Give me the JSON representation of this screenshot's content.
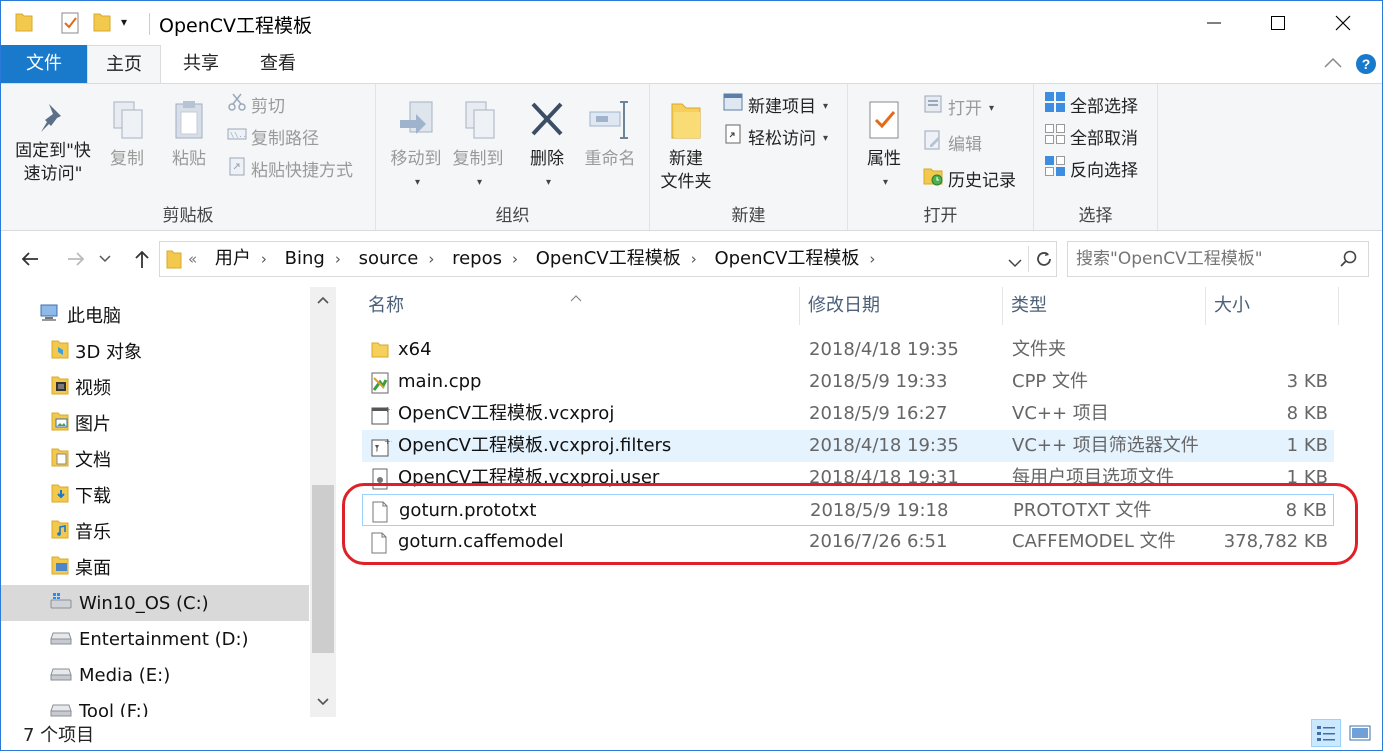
{
  "window": {
    "title": "OpenCV工程模板",
    "minimize": "—",
    "maximize": "☐",
    "close": "✕"
  },
  "ribbon_tabs": [
    "文件",
    "主页",
    "共享",
    "查看"
  ],
  "ribbon": {
    "clipboard": {
      "pin_label_1": "固定到\"快",
      "pin_label_2": "速访问\"",
      "copy": "复制",
      "paste": "粘贴",
      "cut": "剪切",
      "copy_path": "复制路径",
      "paste_shortcut": "粘贴快捷方式",
      "group": "剪贴板"
    },
    "organize": {
      "move_to": "移动到",
      "copy_to": "复制到",
      "delete": "删除",
      "rename": "重命名",
      "group": "组织"
    },
    "new": {
      "new_folder_1": "新建",
      "new_folder_2": "文件夹",
      "new_item": "新建项目",
      "easy_access": "轻松访问",
      "group": "新建"
    },
    "open": {
      "properties": "属性",
      "open": "打开",
      "edit": "编辑",
      "history": "历史记录",
      "group": "打开"
    },
    "select": {
      "select_all": "全部选择",
      "select_none": "全部取消",
      "invert": "反向选择",
      "group": "选择"
    }
  },
  "address": {
    "crumbs": [
      "用户",
      "Bing",
      "source",
      "repos",
      "OpenCV工程模板",
      "OpenCV工程模板"
    ],
    "overflow": "«",
    "search_placeholder": "搜索\"OpenCV工程模板\""
  },
  "nav_pane": {
    "items": [
      {
        "label": "此电脑",
        "icon": "computer-icon"
      },
      {
        "label": "3D 对象",
        "icon": "3d-objects-icon"
      },
      {
        "label": "视频",
        "icon": "videos-icon"
      },
      {
        "label": "图片",
        "icon": "pictures-icon"
      },
      {
        "label": "文档",
        "icon": "documents-icon"
      },
      {
        "label": "下载",
        "icon": "downloads-icon"
      },
      {
        "label": "音乐",
        "icon": "music-icon"
      },
      {
        "label": "桌面",
        "icon": "desktop-icon"
      },
      {
        "label": "Win10_OS (C:)",
        "icon": "system-drive-icon"
      },
      {
        "label": "Entertainment (D:)",
        "icon": "drive-icon"
      },
      {
        "label": "Media (E:)",
        "icon": "drive-icon"
      },
      {
        "label": "Tool (F:)",
        "icon": "drive-icon"
      }
    ],
    "selected_index": 8
  },
  "columns": [
    "名称",
    "修改日期",
    "类型",
    "大小"
  ],
  "files": [
    {
      "name": "x64",
      "date": "2018/4/18 19:35",
      "type": "文件夹",
      "size": "",
      "icon": "folder-icon"
    },
    {
      "name": "main.cpp",
      "date": "2018/5/9 19:33",
      "type": "CPP 文件",
      "size": "3 KB",
      "icon": "cpp-file-icon"
    },
    {
      "name": "OpenCV工程模板.vcxproj",
      "date": "2018/5/9 16:27",
      "type": "VC++ 项目",
      "size": "8 KB",
      "icon": "vcxproj-icon"
    },
    {
      "name": "OpenCV工程模板.vcxproj.filters",
      "date": "2018/4/18 19:35",
      "type": "VC++ 项目筛选器文件",
      "size": "1 KB",
      "icon": "filters-icon"
    },
    {
      "name": "OpenCV工程模板.vcxproj.user",
      "date": "2018/4/18 19:31",
      "type": "每用户项目选项文件",
      "size": "1 KB",
      "icon": "user-file-icon"
    },
    {
      "name": "goturn.prototxt",
      "date": "2018/5/9 19:18",
      "type": "PROTOTXT 文件",
      "size": "8 KB",
      "icon": "blank-file-icon"
    },
    {
      "name": "goturn.caffemodel",
      "date": "2016/7/26 6:51",
      "type": "CAFFEMODEL 文件",
      "size": "378,782 KB",
      "icon": "blank-file-icon"
    }
  ],
  "status": {
    "count": "7 个项目"
  },
  "colors": {
    "accent": "#1979ca",
    "highlight": "#e02028",
    "hover_row": "#e5f3ff"
  }
}
